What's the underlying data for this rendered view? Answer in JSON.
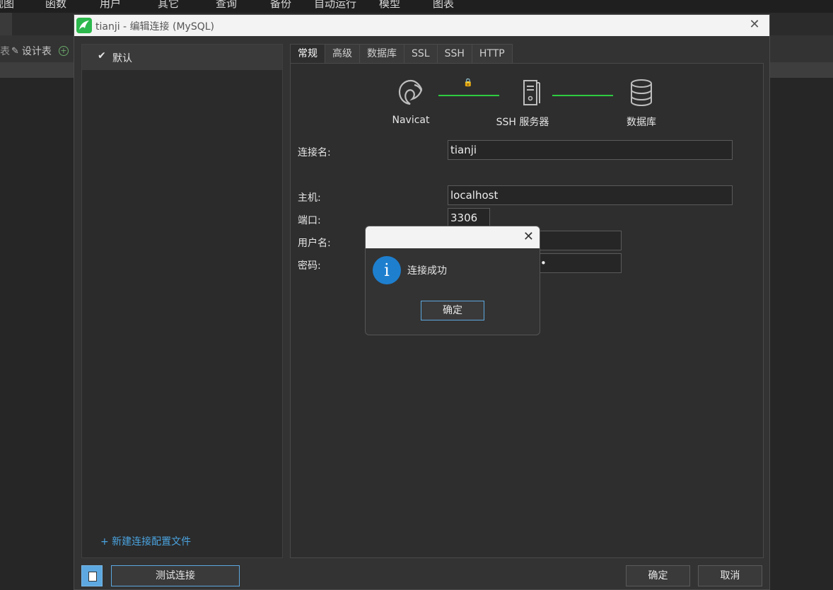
{
  "background": {
    "menu": [
      "视图",
      "函数",
      "用户",
      "其它",
      "查询",
      "备份",
      "自动运行",
      "模型",
      "图表"
    ],
    "toolbar_design_table": "设计表"
  },
  "dialog": {
    "title": "tianji - 编辑连接 (MySQL)",
    "left_panel": {
      "profile": "默认",
      "new_profile": "+ 新建连接配置文件"
    },
    "tabs": [
      "常规",
      "高级",
      "数据库",
      "SSL",
      "SSH",
      "HTTP"
    ],
    "diagram": {
      "node1": "Navicat",
      "node2": "SSH 服务器",
      "node3": "数据库"
    },
    "form": {
      "conn_name_label": "连接名:",
      "conn_name_value": "tianji",
      "host_label": "主机:",
      "host_value": "localhost",
      "port_label": "端口:",
      "port_value": "3306",
      "user_label": "用户名:",
      "password_label": "密码:",
      "password_value": "•"
    },
    "buttons": {
      "test": "测试连接",
      "ok": "确定",
      "cancel": "取消"
    }
  },
  "message_box": {
    "text": "连接成功",
    "ok": "确定"
  },
  "colors": {
    "accent": "#5da8e0",
    "link_green": "#2ecc40",
    "info_blue": "#1e7fcf"
  }
}
